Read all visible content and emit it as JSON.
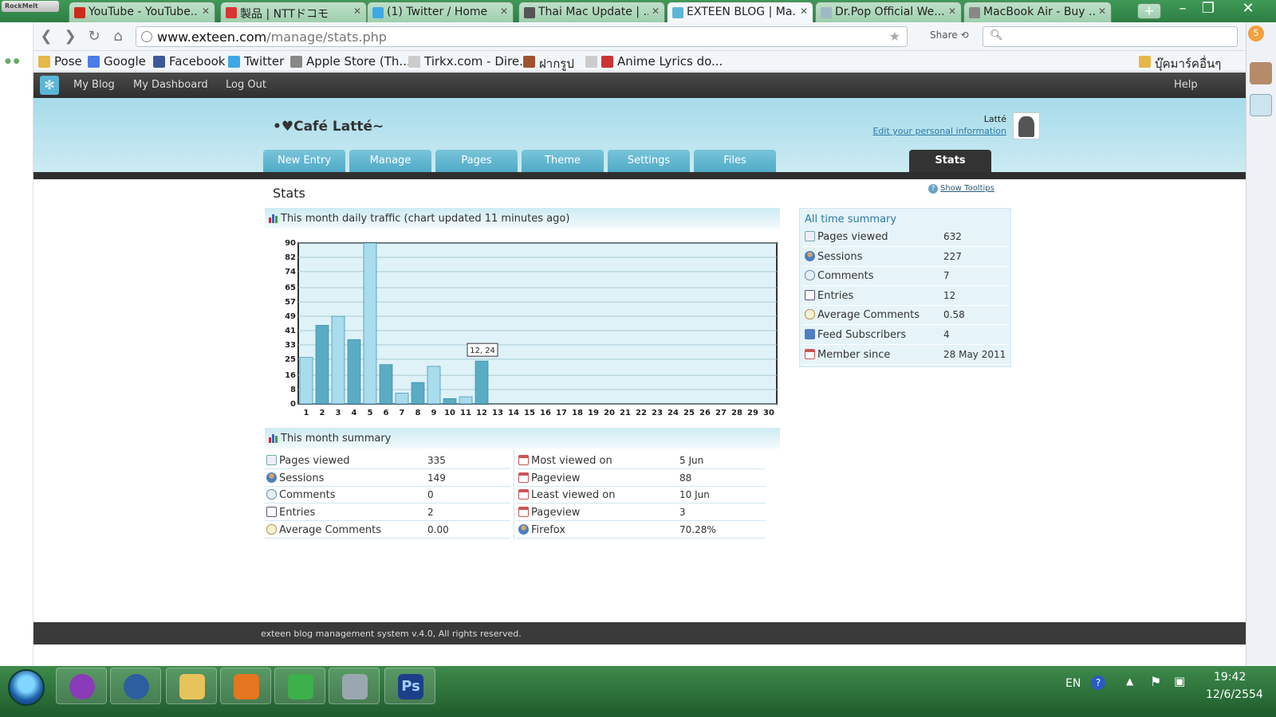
{
  "browser": {
    "rockmelt_label": "RockMelt",
    "tabs": [
      {
        "label": "YouTube - YouTube...",
        "color": "#cc2a1b"
      },
      {
        "label": "製品 | NTTドコモ",
        "color": "#d83333"
      },
      {
        "label": "(1) Twitter / Home",
        "color": "#3ea8e5"
      },
      {
        "label": "Thai Mac Update | ...",
        "color": "#555555"
      },
      {
        "label": "EXTEEN BLOG | Ma...",
        "color": "#5bb6d8"
      },
      {
        "label": "Dr.Pop Official We...",
        "color": "#9fb8c6"
      },
      {
        "label": "MacBook Air - Buy ...",
        "color": "#888888"
      }
    ],
    "active_tab": 4,
    "url_host": "www.exteen.com",
    "url_path": "/manage/stats.php",
    "share_label": "Share",
    "bookmarks": [
      {
        "label": "Pose",
        "color": "#e6b84a"
      },
      {
        "label": "Google",
        "color": "#4a7de6"
      },
      {
        "label": "Facebook",
        "color": "#3b5998"
      },
      {
        "label": "Twitter",
        "color": "#3ea8e5"
      },
      {
        "label": "Apple Store (Th...",
        "color": "#888888"
      },
      {
        "label": "Tirkx.com - Dire...",
        "color": "#cccccc"
      },
      {
        "label": "ฝากรูป",
        "color": "#a0522d"
      },
      {
        "label": "",
        "color": "#cccccc"
      },
      {
        "label": "Anime Lyrics do...",
        "color": "#cc3333"
      }
    ],
    "other_bookmarks": "บุ๊คมาร์คอื่นๆ",
    "sidebar_badge": "5"
  },
  "site": {
    "topnav": [
      "My Blog",
      "My Dashboard",
      "Log Out"
    ],
    "help": "Help",
    "blog_title": "•♥Café Latté~",
    "user_name": "Latté",
    "edit_info": "Edit your personal information",
    "tabs": [
      "New Entry",
      "Manage",
      "Pages",
      "Theme",
      "Settings",
      "Files",
      "Stats"
    ],
    "active_tab": "Stats",
    "page_title": "Stats",
    "show_tooltips": "Show Tooltips",
    "footer": "exteen blog management system v.4.0, All rights reserved."
  },
  "traffic_chart": {
    "heading": "This month daily traffic (chart updated 11 minutes ago)",
    "tooltip": "12, 24",
    "tooltip_icon": "tooltip-icon"
  },
  "chart_data": {
    "type": "bar",
    "categories": [
      "1",
      "2",
      "3",
      "4",
      "5",
      "6",
      "7",
      "8",
      "9",
      "10",
      "11",
      "12",
      "13",
      "14",
      "15",
      "16",
      "17",
      "18",
      "19",
      "20",
      "21",
      "22",
      "23",
      "24",
      "25",
      "26",
      "27",
      "28",
      "29",
      "30"
    ],
    "values": [
      26,
      44,
      49,
      36,
      90,
      22,
      6,
      12,
      21,
      3,
      4,
      24,
      null,
      null,
      null,
      null,
      null,
      null,
      null,
      null,
      null,
      null,
      null,
      null,
      null,
      null,
      null,
      null,
      null,
      null
    ],
    "ylim": [
      0,
      90
    ],
    "yticks": [
      "0",
      "8",
      "16",
      "25",
      "33",
      "41",
      "49",
      "57",
      "65",
      "74",
      "82",
      "90"
    ],
    "bar_colors": [
      "#a9dcec",
      "#5aacc4"
    ],
    "grid": true
  },
  "all_time": {
    "title": "All time summary",
    "rows": [
      {
        "label": "Pages viewed",
        "value": "632",
        "icon": "ico-page"
      },
      {
        "label": "Sessions",
        "value": "227",
        "icon": "ico-user"
      },
      {
        "label": "Comments",
        "value": "7",
        "icon": "ico-comment"
      },
      {
        "label": "Entries",
        "value": "12",
        "icon": "ico-entry"
      },
      {
        "label": "Average Comments",
        "value": "0.58",
        "icon": "ico-avgc"
      },
      {
        "label": "Feed Subscribers",
        "value": "4",
        "icon": "ico-feed"
      },
      {
        "label": "Member since",
        "value": "28 May 2011",
        "icon": "ico-cal"
      }
    ]
  },
  "month_summary": {
    "title": "This month summary",
    "left": [
      {
        "label": "Pages viewed",
        "value": "335",
        "icon": "ico-page"
      },
      {
        "label": "Sessions",
        "value": "149",
        "icon": "ico-user"
      },
      {
        "label": "Comments",
        "value": "0",
        "icon": "ico-comment"
      },
      {
        "label": "Entries",
        "value": "2",
        "icon": "ico-entry"
      },
      {
        "label": "Average Comments",
        "value": "0.00",
        "icon": "ico-avgc"
      }
    ],
    "right": [
      {
        "label": "Most viewed on",
        "value": "5 Jun",
        "icon": "ico-cal"
      },
      {
        "label": "Pageview",
        "value": "88",
        "icon": "ico-cal"
      },
      {
        "label": "Least viewed on",
        "value": "10 Jun",
        "icon": "ico-cal"
      },
      {
        "label": "Pageview",
        "value": "3",
        "icon": "ico-cal"
      },
      {
        "label": "Firefox",
        "value": "70.28%",
        "icon": "ico-user"
      }
    ]
  },
  "taskbar": {
    "apps": [
      {
        "name": "sims-app",
        "color": "#8a3bb8"
      },
      {
        "name": "globe-app",
        "color": "#2d5f9e"
      },
      {
        "name": "explorer-app",
        "color": "#e8c25a"
      },
      {
        "name": "firefox-app",
        "color": "#e5761f"
      },
      {
        "name": "messenger-app",
        "color": "#3cb04b"
      },
      {
        "name": "camera-app",
        "color": "#9aa7b0"
      },
      {
        "name": "photoshop-app",
        "color": "#1d3f8a"
      }
    ],
    "photoshop_label": "Ps",
    "lang": "EN",
    "time": "19:42",
    "date": "12/6/2554"
  }
}
